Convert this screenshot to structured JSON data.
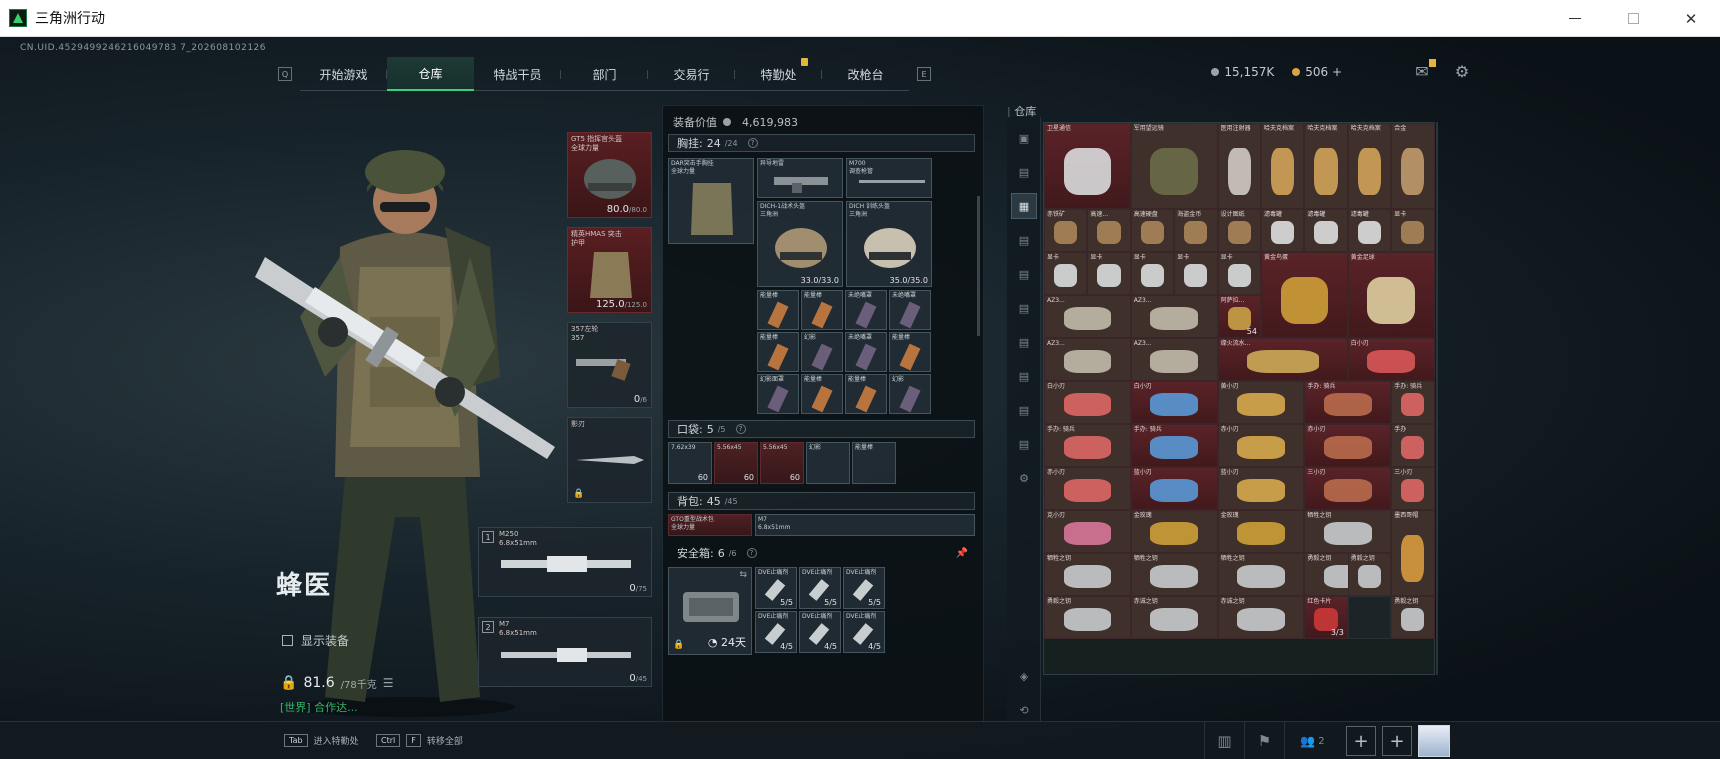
{
  "window": {
    "title": "三角洲行动"
  },
  "uid": "CN.UID.4529499246216049783 7_202608102126",
  "nav": {
    "left_key": "Q",
    "right_key": "E",
    "tabs": [
      {
        "label": "开始游戏"
      },
      {
        "label": "仓库",
        "active": true
      },
      {
        "label": "特战干员"
      },
      {
        "label": "部门"
      },
      {
        "label": "交易行"
      },
      {
        "label": "特勤处",
        "badge": true
      },
      {
        "label": "改枪台"
      }
    ]
  },
  "currency": {
    "silver": "15,157K",
    "gold": "506 +"
  },
  "operator": {
    "name": "蜂医",
    "show_equipment": "显示装备",
    "weight": "81.6",
    "weight_max": "/78千克",
    "chat": "[世界] 合作达..."
  },
  "equipment": {
    "helmet": {
      "label": "GT5 指挥官头盔\n全球力量",
      "value": "80.0",
      "max": "/80.0"
    },
    "armor": {
      "label": "精英HMAS 突击\n护甲",
      "value": "125.0",
      "max": "/125.0"
    },
    "pistol": {
      "label": "357左轮\n357",
      "value": "0",
      "max": "/6"
    },
    "melee": {
      "label": "影刃"
    },
    "primary": {
      "num": "1",
      "label": "M250\n6.8x51mm",
      "value": "0",
      "max": "/75"
    },
    "secondary": {
      "num": "2",
      "label": "M7\n6.8x51mm",
      "value": "0",
      "max": "/45"
    }
  },
  "center": {
    "equip_value_label": "装备价值",
    "equip_value": "4,619,983",
    "chest": {
      "label": "胸挂:",
      "count": "24",
      "max": "/24"
    },
    "pocket": {
      "label": "口袋:",
      "count": "5",
      "max": "/5"
    },
    "backpack": {
      "label": "背包:",
      "count": "45",
      "max": "/45"
    },
    "safebox": {
      "label": "安全箱:",
      "count": "6",
      "max": "/6",
      "days": "24天"
    },
    "chest_items": [
      {
        "label": "DAR突击手胸挂\n全球力量"
      },
      {
        "label": "异导地雷"
      },
      {
        "label": "M700\n调查枪管"
      },
      {
        "label": "DICH-1战术头盔\n三角洲",
        "value": "33.0/33.0"
      },
      {
        "label": "DICH 训练头盔\n三角洲",
        "value": "35.0/35.0"
      }
    ],
    "chest_small": [
      "能量棒",
      "能量棒",
      "未绝嘴罩",
      "未绝嘴罩",
      "能量棒",
      "幻影",
      "未绝嘴罩",
      "能量棒",
      "幻影面罩",
      "能量棒",
      "能量棒",
      "幻影"
    ],
    "pocket_items": [
      {
        "label": "7.62x39",
        "value": "60"
      },
      {
        "label": "5.56x45",
        "value": "60"
      },
      {
        "label": "5.56x45",
        "value": "60"
      },
      {
        "label": "幻影"
      },
      {
        "label": "能量棒"
      }
    ],
    "backpack_items": [
      {
        "label": "GTO重型战术包\n全球力量"
      },
      {
        "label": "M7\n6.8x51mm"
      }
    ],
    "safebox_items": [
      {
        "label": "DVE止痛剂",
        "value": "5/5"
      },
      {
        "label": "DVE止痛剂",
        "value": "5/5"
      },
      {
        "label": "DVE止痛剂",
        "value": "5/5"
      },
      {
        "label": "DVE止痛剂",
        "value": "4/5"
      },
      {
        "label": "DVE止痛剂",
        "value": "4/5"
      },
      {
        "label": "DVE止痛剂",
        "value": "4/5"
      }
    ]
  },
  "warehouse": {
    "title": "仓库",
    "row1": [
      {
        "label": "卫星通信"
      },
      {
        "label": "军用望远镜"
      },
      {
        "label": "医用注射器"
      },
      {
        "label": "哈夫克档案"
      },
      {
        "label": "哈夫克档案"
      },
      {
        "label": "哈夫克档案"
      },
      {
        "label": "合金"
      }
    ],
    "row2": [
      "赤铁矿",
      "高速...",
      "高速硬盘",
      "海盗金币",
      "设计图纸",
      "滤毒罐",
      "滤毒罐",
      "滤毒罐",
      "显卡"
    ],
    "row3": [
      "显卡",
      "显卡",
      "显卡",
      "显卡",
      "显卡"
    ],
    "gold_items": [
      {
        "label": "黄金鸟蛋"
      },
      {
        "label": "黄金足球"
      }
    ],
    "maps": [
      "AZ3...",
      "AZ3...",
      "AZ3...",
      "AZ3..."
    ],
    "special": [
      {
        "label": "阿萨拉..."
      },
      {
        "label": "缘火流水..."
      },
      {
        "label": "白小刃"
      }
    ],
    "special_count": "54",
    "row6": [
      "白小刃",
      "白小刃",
      "黄小刃",
      "手办: 骑兵",
      "手办: 骑兵"
    ],
    "row7": [
      "手办: 骑兵",
      "手办: 骑兵",
      "赤小刃",
      "赤小刃",
      "手办"
    ],
    "row8": [
      "赤小刃",
      "蓝小刃",
      "蓝小刃",
      "三小刃",
      "三小刃"
    ],
    "row9": [
      "克小刃",
      "金玫瑰",
      "金玫瑰",
      "牺牲之钥",
      "墨西哥帽"
    ],
    "row10": [
      "牺牲之钥",
      "牺牲之钥",
      "牺牲之钥",
      "勇毅之钥",
      "勇毅之钥"
    ],
    "row11": [
      "勇毅之钥",
      "赤诚之钥",
      "赤诚之钥",
      "红色卡片"
    ],
    "red_card_count": "3/3"
  },
  "bottom": {
    "hint1_key": "Tab",
    "hint1": "进入特勤处",
    "hint2_key": "Ctrl",
    "hint2_key2": "F",
    "hint2": "转移全部",
    "friends": "2"
  }
}
